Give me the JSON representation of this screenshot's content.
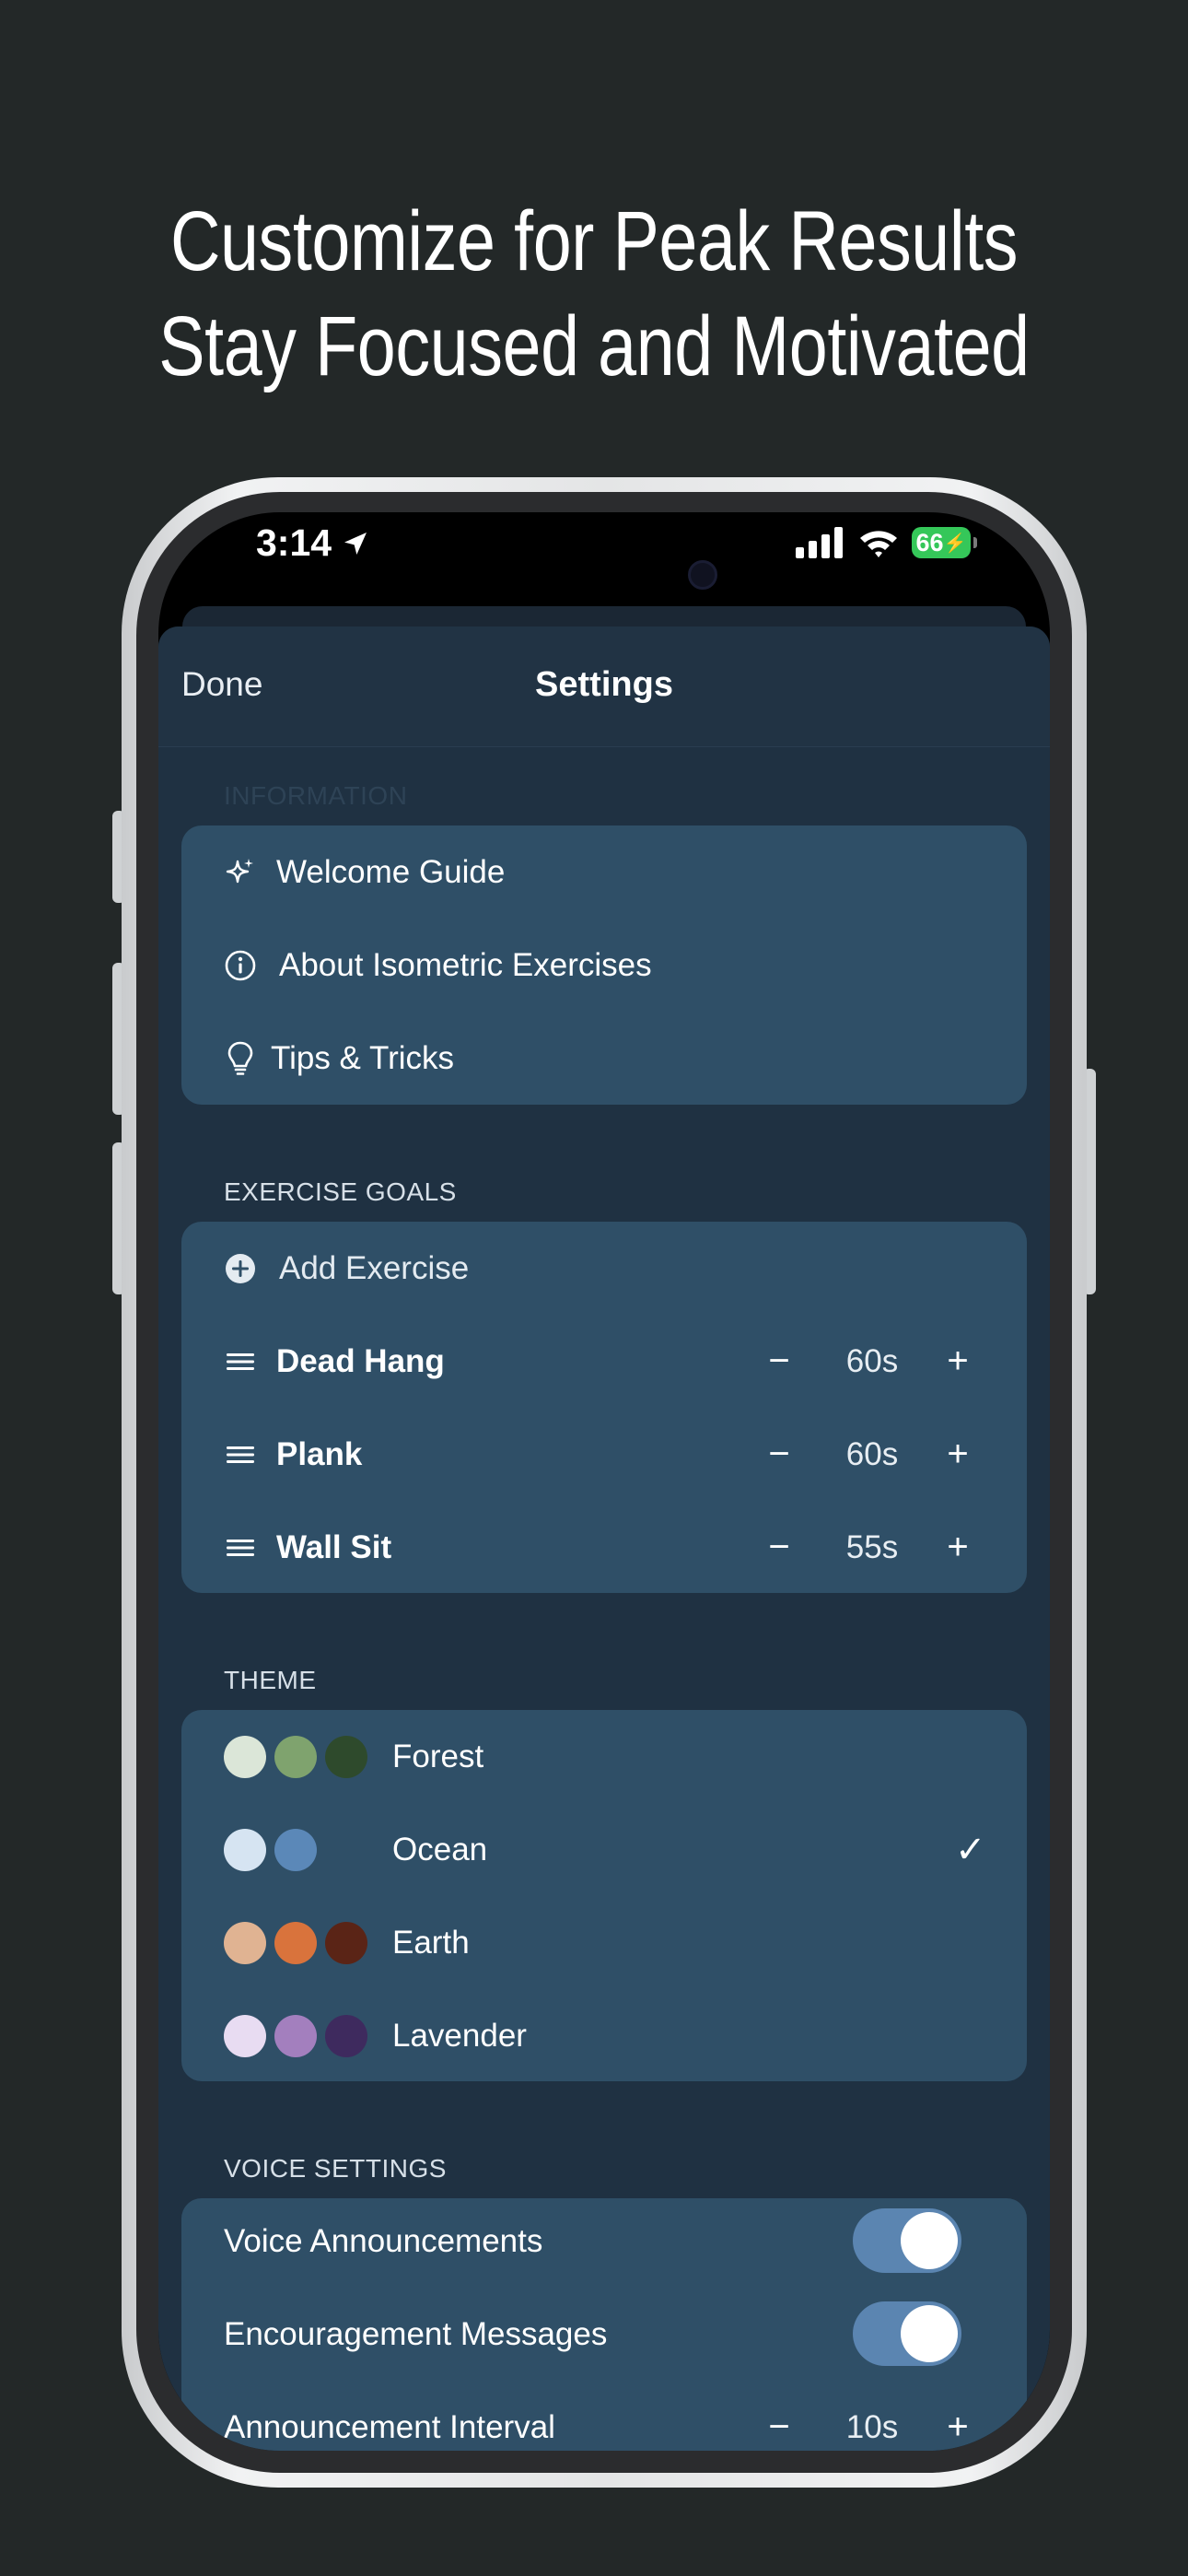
{
  "headline": {
    "line1": "Customize for Peak Results",
    "line2": "Stay Focused and Motivated"
  },
  "status_bar": {
    "time": "3:14",
    "battery": "66",
    "icons": [
      "location-arrow-icon",
      "cellular-signal-icon",
      "wifi-icon",
      "battery-charging-icon"
    ]
  },
  "navbar": {
    "done_label": "Done",
    "title": "Settings"
  },
  "information": {
    "header": "INFORMATION",
    "items": [
      {
        "label": "Welcome Guide",
        "icon": "sparkles-icon"
      },
      {
        "label": "About Isometric Exercises",
        "icon": "info-circle-icon"
      },
      {
        "label": "Tips & Tricks",
        "icon": "lightbulb-icon"
      }
    ]
  },
  "exercise_goals": {
    "header": "EXERCISE GOALS",
    "add_label": "Add Exercise",
    "items": [
      {
        "name": "Dead Hang",
        "value": "60s"
      },
      {
        "name": "Plank",
        "value": "60s"
      },
      {
        "name": "Wall Sit",
        "value": "55s"
      }
    ],
    "minus_symbol": "−",
    "plus_symbol": "+"
  },
  "theme": {
    "header": "THEME",
    "selected": "Ocean",
    "check_symbol": "✓",
    "items": [
      {
        "name": "Forest",
        "colors": [
          "#dbe6d8",
          "#7fa36e",
          "#2e4a2c"
        ]
      },
      {
        "name": "Ocean",
        "colors": [
          "#d6e4f2",
          "#5b88b8"
        ]
      },
      {
        "name": "Earth",
        "colors": [
          "#e0b392",
          "#d9733c",
          "#5a2416"
        ]
      },
      {
        "name": "Lavender",
        "colors": [
          "#e8dcf2",
          "#a37fbe",
          "#3e2a5e"
        ]
      }
    ]
  },
  "voice_settings": {
    "header": "VOICE SETTINGS",
    "voice_announcements": {
      "label": "Voice Announcements",
      "enabled": true
    },
    "encouragement_messages": {
      "label": "Encouragement Messages",
      "enabled": true
    },
    "announcement_interval": {
      "label": "Announcement Interval",
      "value": "10s"
    }
  },
  "colors": {
    "page_background": "#232828",
    "sheet_background": "#1f3142",
    "group_background": "#2f4f67",
    "toggle_on": "#5b85b1",
    "battery_green": "#35c759"
  }
}
